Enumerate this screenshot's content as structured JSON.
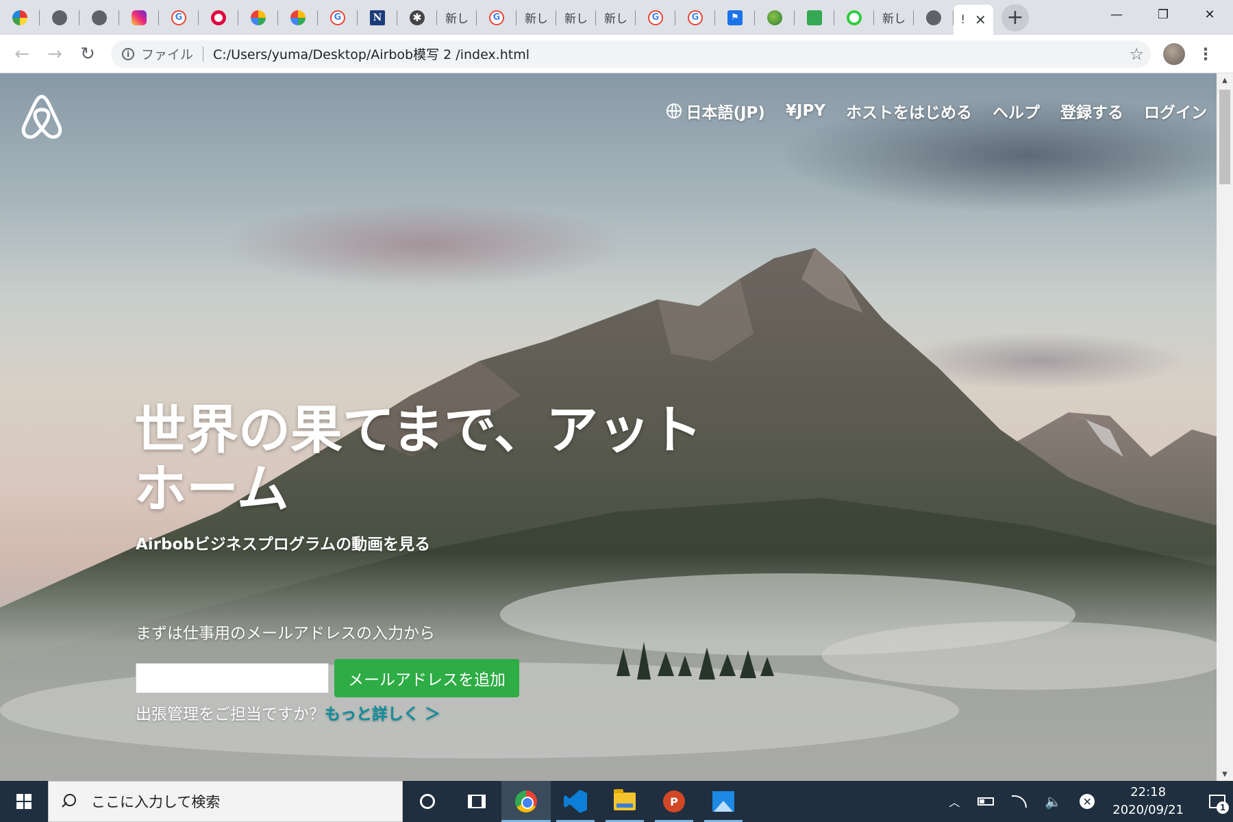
{
  "browser": {
    "tabs": [
      {
        "icon": "colorful-logo-icon",
        "label": ""
      },
      {
        "icon": "globe-icon",
        "label": ""
      },
      {
        "icon": "globe-icon",
        "label": ""
      },
      {
        "icon": "instagram-icon",
        "label": ""
      },
      {
        "icon": "google-icon",
        "label": "G"
      },
      {
        "icon": "target-icon",
        "label": ""
      },
      {
        "icon": "pinwheel-icon",
        "label": ""
      },
      {
        "icon": "pinwheel-icon",
        "label": ""
      },
      {
        "icon": "google-icon",
        "label": "G"
      },
      {
        "icon": "n-logo-icon",
        "label": "N"
      },
      {
        "icon": "asterisk-icon",
        "label": "✱"
      },
      {
        "icon": "",
        "label": "新し"
      },
      {
        "icon": "google-icon",
        "label": "G"
      },
      {
        "icon": "",
        "label": "新し"
      },
      {
        "icon": "",
        "label": "新し"
      },
      {
        "icon": "",
        "label": "新し"
      },
      {
        "icon": "google-icon",
        "label": "G"
      },
      {
        "icon": "google-icon",
        "label": "G"
      },
      {
        "icon": "flag-icon",
        "label": "⚑"
      },
      {
        "icon": "earth-icon",
        "label": ""
      },
      {
        "icon": "book-icon",
        "label": ""
      },
      {
        "icon": "ring-icon",
        "label": ""
      },
      {
        "icon": "",
        "label": "新し"
      },
      {
        "icon": "globe-icon",
        "label": ""
      }
    ],
    "active_tab_label": "!",
    "newtab_label": "+",
    "window": {
      "minimize": "—",
      "restore": "❐",
      "close": "✕"
    },
    "address": {
      "scheme_label": "ファイル",
      "url": "C:/Users/yuma/Desktop/Airbob模写 2 /index.html"
    }
  },
  "page": {
    "nav": {
      "language": "日本語(JP)",
      "currency": "¥JPY",
      "host": "ホストをはじめる",
      "help": "ヘルプ",
      "signup": "登録する",
      "login": "ログイン"
    },
    "headline": "世界の果てまで、アットホーム",
    "video_link": "Airbobビジネスプログラムの動画を見る",
    "email_prompt": "まずは仕事用のメールアドレスの入力から",
    "email_value": "",
    "add_email_button": "メールアドレスを追加",
    "business_question": "出張管理をご担当ですか？",
    "learn_more": "もっと詳しく ＞"
  },
  "taskbar": {
    "search_placeholder": "ここに入力して検索",
    "time": "22:18",
    "date": "2020/09/21",
    "notification_count": "1",
    "ppt_letter": "P"
  },
  "colors": {
    "accent_green": "#2eac45",
    "learn_more_teal": "#0a8d9c",
    "taskbar_bg": "#1f2f3f",
    "tabstrip_bg": "#dee1e6"
  }
}
